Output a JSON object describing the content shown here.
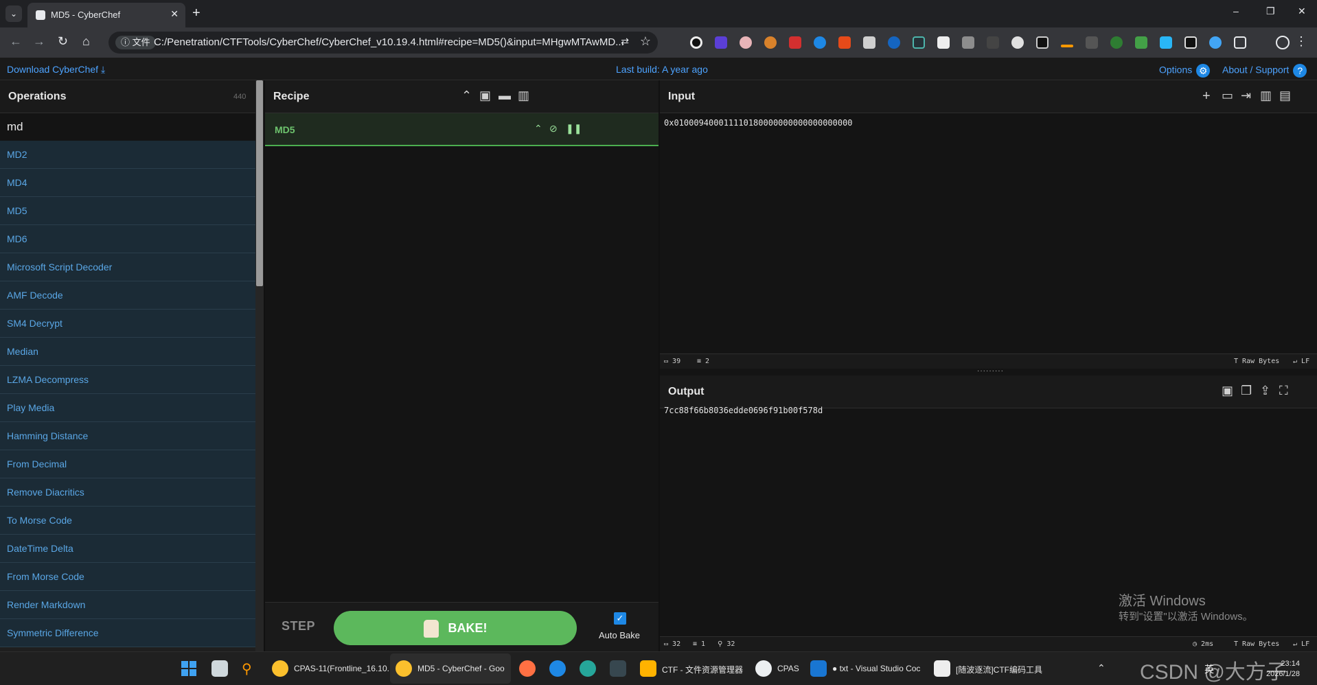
{
  "browser": {
    "tab_title": "MD5 - CyberChef",
    "info_chip": "文件",
    "url": "C:/Penetration/CTFTools/CyberChef/CyberChef_v10.19.4.html#recipe=MD5()&input=MHgwMTAwMD...",
    "window_controls": [
      "–",
      "❐",
      "✕"
    ]
  },
  "banner": {
    "download_label": "Download CyberChef",
    "build_label": "Last build: A year ago",
    "options_label": "Options",
    "about_label": "About / Support"
  },
  "operations": {
    "title": "Operations",
    "count": "440",
    "search_value": "md",
    "items": [
      "MD2",
      "MD4",
      "MD5",
      "MD6",
      "Microsoft Script Decoder",
      "AMF Decode",
      "SM4 Decrypt",
      "Median",
      "LZMA Decompress",
      "Play Media",
      "Hamming Distance",
      "From Decimal",
      "Remove Diacritics",
      "To Morse Code",
      "DateTime Delta",
      "From Morse Code",
      "Render Markdown",
      "Symmetric Difference"
    ]
  },
  "recipe": {
    "title": "Recipe",
    "operation_name": "MD5",
    "step_label": "STEP",
    "bake_label": "BAKE!",
    "auto_bake_label": "Auto Bake",
    "auto_bake_checked": true
  },
  "input": {
    "title": "Input",
    "text": "0x010009400011110180000000000000000000",
    "length": "39",
    "lines": "2",
    "encoding": "Raw Bytes",
    "eol": "LF"
  },
  "output": {
    "title": "Output",
    "text": "7cc88f66b8036edde0696f91b00f578d",
    "length": "32",
    "lines": "1",
    "position": "32",
    "bake_time": "2ms",
    "encoding": "Raw Bytes",
    "eol": "LF"
  },
  "windows_activation": {
    "line1": "激活 Windows",
    "line2": "转到\"设置\"以激活 Windows。"
  },
  "taskbar": {
    "items": [
      {
        "label": "CPAS-11(Frontline_16.10."
      },
      {
        "label": "MD5 - CyberChef - Goo"
      },
      {
        "label": "CTF - 文件资源管理器"
      },
      {
        "label": "CPAS"
      },
      {
        "label": "● txt - Visual Studio Coc"
      },
      {
        "label": "[随波逐流]CTF编码工具"
      }
    ],
    "tray_lang": "英",
    "time": "23:14",
    "date": "2026/1/28",
    "watermark": "CSDN @大方子"
  },
  "colors": {
    "accent_blue": "#4da3ff",
    "bake_green": "#5cb85c",
    "op_item_bg": "#1b2b36"
  }
}
